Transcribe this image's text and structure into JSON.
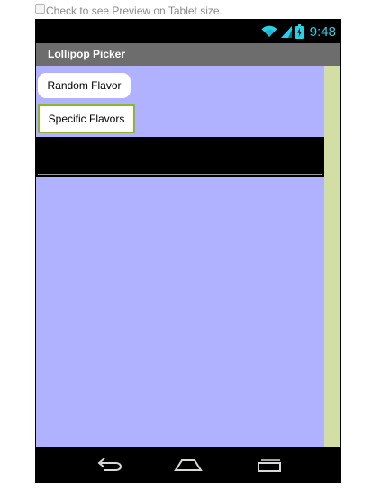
{
  "preview_option": {
    "label": "Check to see Preview on Tablet size.",
    "checked": false
  },
  "status_bar": {
    "icons": [
      "wifi-icon",
      "cell-signal-icon",
      "battery-charging-icon"
    ],
    "time": "9:48",
    "accent_color": "#2ad0e6"
  },
  "app": {
    "title": "Lollipop Picker",
    "title_bar_color": "#6d6d6d",
    "screen_color": "#b1b2ff",
    "side_strip_color": "#d2dea4"
  },
  "buttons": {
    "random_flavor": "Random Flavor",
    "specific_flavors": "Specific Flavors",
    "specific_border_color": "#8db72a"
  },
  "navigation": {
    "icons": [
      "back-icon",
      "home-icon",
      "recent-apps-icon"
    ]
  }
}
